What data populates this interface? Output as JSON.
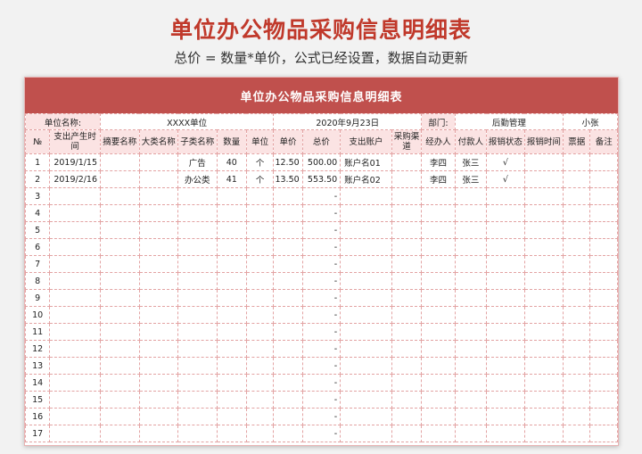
{
  "page": {
    "title": "单位办公物品采购信息明细表",
    "subtitle": "总价 = 数量*单价，公式已经设置，数据自动更新"
  },
  "sheet": {
    "title": "单位办公物品采购信息明细表",
    "info": {
      "unit_label": "单位名称:",
      "unit_value": "XXXX单位",
      "date": "2020年9月23日",
      "dept_label": "部门:",
      "dept_value": "后勤管理",
      "person": "小张"
    },
    "columns": [
      "№",
      "支出产生时间",
      "摘要名称",
      "大类名称",
      "子类名称",
      "数量",
      "单位",
      "单价",
      "总价",
      "支出账户",
      "采购渠道",
      "经办人",
      "付款人",
      "报销状态",
      "报销时间",
      "票据",
      "备注"
    ],
    "rows": [
      [
        "1",
        "2019/1/15",
        "",
        "",
        "广告",
        "40",
        "个",
        "12.50",
        "500.00",
        "账户名01",
        "",
        "李四",
        "张三",
        "√",
        "",
        "",
        ""
      ],
      [
        "2",
        "2019/2/16",
        "",
        "",
        "办公类",
        "41",
        "个",
        "13.50",
        "553.50",
        "账户名02",
        "",
        "李四",
        "张三",
        "√",
        "",
        "",
        ""
      ],
      [
        "3",
        "",
        "",
        "",
        "",
        "",
        "",
        "",
        "-",
        "",
        "",
        "",
        "",
        "",
        "",
        "",
        ""
      ],
      [
        "4",
        "",
        "",
        "",
        "",
        "",
        "",
        "",
        "-",
        "",
        "",
        "",
        "",
        "",
        "",
        "",
        ""
      ],
      [
        "5",
        "",
        "",
        "",
        "",
        "",
        "",
        "",
        "-",
        "",
        "",
        "",
        "",
        "",
        "",
        "",
        ""
      ],
      [
        "6",
        "",
        "",
        "",
        "",
        "",
        "",
        "",
        "-",
        "",
        "",
        "",
        "",
        "",
        "",
        "",
        ""
      ],
      [
        "7",
        "",
        "",
        "",
        "",
        "",
        "",
        "",
        "-",
        "",
        "",
        "",
        "",
        "",
        "",
        "",
        ""
      ],
      [
        "8",
        "",
        "",
        "",
        "",
        "",
        "",
        "",
        "-",
        "",
        "",
        "",
        "",
        "",
        "",
        "",
        ""
      ],
      [
        "9",
        "",
        "",
        "",
        "",
        "",
        "",
        "",
        "-",
        "",
        "",
        "",
        "",
        "",
        "",
        "",
        ""
      ],
      [
        "10",
        "",
        "",
        "",
        "",
        "",
        "",
        "",
        "-",
        "",
        "",
        "",
        "",
        "",
        "",
        "",
        ""
      ],
      [
        "11",
        "",
        "",
        "",
        "",
        "",
        "",
        "",
        "-",
        "",
        "",
        "",
        "",
        "",
        "",
        "",
        ""
      ],
      [
        "12",
        "",
        "",
        "",
        "",
        "",
        "",
        "",
        "-",
        "",
        "",
        "",
        "",
        "",
        "",
        "",
        ""
      ],
      [
        "13",
        "",
        "",
        "",
        "",
        "",
        "",
        "",
        "-",
        "",
        "",
        "",
        "",
        "",
        "",
        "",
        ""
      ],
      [
        "14",
        "",
        "",
        "",
        "",
        "",
        "",
        "",
        "-",
        "",
        "",
        "",
        "",
        "",
        "",
        "",
        ""
      ],
      [
        "15",
        "",
        "",
        "",
        "",
        "",
        "",
        "",
        "-",
        "",
        "",
        "",
        "",
        "",
        "",
        "",
        ""
      ],
      [
        "16",
        "",
        "",
        "",
        "",
        "",
        "",
        "",
        "-",
        "",
        "",
        "",
        "",
        "",
        "",
        "",
        ""
      ],
      [
        "17",
        "",
        "",
        "",
        "",
        "",
        "",
        "",
        "-",
        "",
        "",
        "",
        "",
        "",
        "",
        "",
        ""
      ]
    ]
  },
  "colors": {
    "accent": "#c0504d",
    "title_red": "#c0392b",
    "header_fill": "#fbe3e3",
    "grid_line": "#e3a3a3"
  }
}
